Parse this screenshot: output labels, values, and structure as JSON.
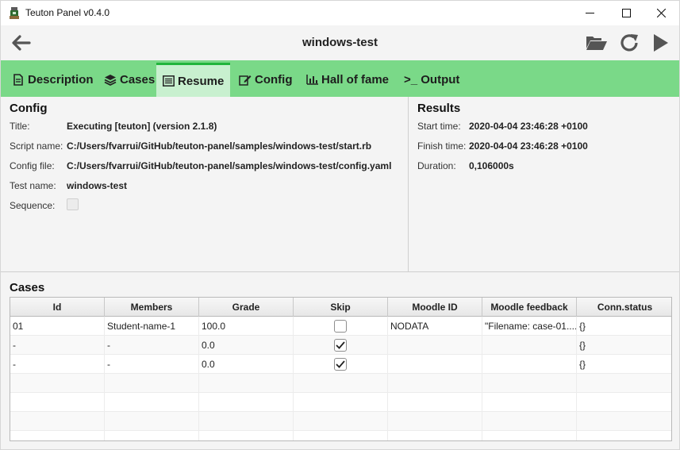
{
  "window": {
    "title": "Teuton Panel v0.4.0",
    "heading": "windows-test"
  },
  "icons": {
    "app": "teuton-app-icon",
    "minimize": "minimize-icon",
    "maximize": "maximize-icon",
    "close": "close-icon",
    "back": "arrow-left-icon",
    "open": "folder-open-icon",
    "reload": "reload-icon",
    "run": "play-icon"
  },
  "tabs": [
    {
      "label": "Description",
      "icon": "file-text-icon"
    },
    {
      "label": "Cases",
      "icon": "layers-icon"
    },
    {
      "label": "Resume",
      "icon": "list-alt-icon",
      "active": true
    },
    {
      "label": "Config",
      "icon": "edit-icon"
    },
    {
      "label": "Hall of fame",
      "icon": "bar-chart-icon"
    },
    {
      "label": ">_ Output",
      "icon": "terminal-icon"
    }
  ],
  "config": {
    "title": "Config",
    "rows": [
      {
        "label": "Title:",
        "value": "Executing [teuton] (version 2.1.8)"
      },
      {
        "label": "Script name:",
        "value": "C:/Users/fvarrui/GitHub/teuton-panel/samples/windows-test/start.rb"
      },
      {
        "label": "Config file:",
        "value": "C:/Users/fvarrui/GitHub/teuton-panel/samples/windows-test/config.yaml"
      },
      {
        "label": "Test name:",
        "value": "windows-test"
      },
      {
        "label": "Sequence:",
        "value": ""
      }
    ],
    "sequence_checked": false
  },
  "results": {
    "title": "Results",
    "rows": [
      {
        "label": "Start time:",
        "value": "2020-04-04 23:46:28 +0100"
      },
      {
        "label": "Finish time:",
        "value": "2020-04-04 23:46:28 +0100"
      },
      {
        "label": "Duration:",
        "value": "0,106000s"
      }
    ]
  },
  "cases": {
    "title": "Cases",
    "columns": [
      "Id",
      "Members",
      "Grade",
      "Skip",
      "Moodle ID",
      "Moodle feedback",
      "Conn.status"
    ],
    "rows": [
      {
        "id": "01",
        "members": "Student-name-1",
        "grade": "100.0",
        "skip": false,
        "moodle_id": "NODATA",
        "moodle_feedback": "\"Filename: case-01....",
        "conn_status": "{}"
      },
      {
        "id": "-",
        "members": "-",
        "grade": "0.0",
        "skip": true,
        "moodle_id": "",
        "moodle_feedback": "",
        "conn_status": "{}"
      },
      {
        "id": "-",
        "members": "-",
        "grade": "0.0",
        "skip": true,
        "moodle_id": "",
        "moodle_feedback": "",
        "conn_status": "{}"
      }
    ]
  }
}
